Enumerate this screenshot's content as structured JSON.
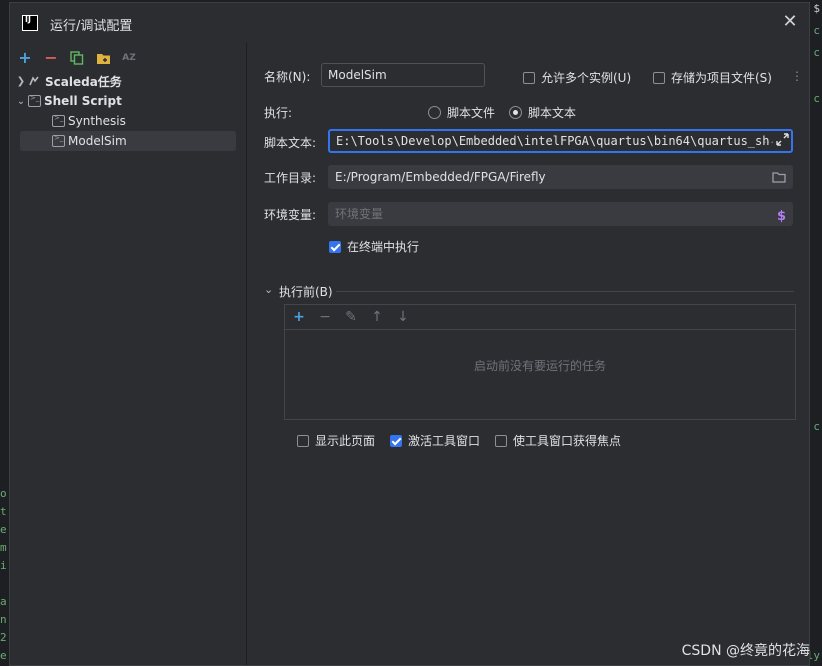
{
  "window": {
    "title": "运行/调试配置",
    "close_label": "✕"
  },
  "background_editor": {
    "left_glyphs": [
      "o",
      "t",
      "e",
      "m",
      "i",
      "",
      "a",
      "n",
      "t",
      "2",
      "e"
    ],
    "right_glyphs": [
      "$",
      "c",
      "c",
      "c",
      "c",
      "ly"
    ]
  },
  "toolbar": {
    "add": "+",
    "remove": "−",
    "copy": "copy",
    "folder": "folder",
    "sort": "AZ"
  },
  "tree": [
    {
      "label": "Scaleda任务",
      "expanded": false,
      "bold": true
    },
    {
      "label": "Shell Script",
      "expanded": true,
      "bold": true
    },
    {
      "label": "Synthesis",
      "child": true
    },
    {
      "label": "ModelSim",
      "child": true,
      "selected": true
    }
  ],
  "form": {
    "name_label": "名称(N):",
    "name_value": "ModelSim",
    "allow_multiple_label": "允许多个实例(U)",
    "allow_multiple_checked": false,
    "store_as_file_label": "存储为项目文件(S)",
    "store_as_file_checked": false,
    "execute_label": "执行:",
    "radio_script_file": "脚本文件",
    "radio_script_text": "脚本文本",
    "selected_radio": "脚本文本",
    "script_text_label": "脚本文本:",
    "script_text_value": "E:\\Tools\\Develop\\Embedded\\intelFPGA\\quartus\\bin64\\quartus_sh",
    "workdir_label": "工作目录:",
    "workdir_value": "E:/Program/Embedded/FPGA/Firefly",
    "env_label": "环境变量:",
    "env_placeholder": "环境变量",
    "run_in_terminal_label": "在终端中执行",
    "run_in_terminal_checked": true
  },
  "before_launch": {
    "header": "执行前(B)",
    "empty_message": "启动前没有要运行的任务",
    "show_page_label": "显示此页面",
    "show_page_checked": false,
    "activate_tool_window_label": "激活工具窗口",
    "activate_tool_window_checked": true,
    "focus_tool_window_label": "使工具窗口获得焦点",
    "focus_tool_window_checked": false
  },
  "watermark": "CSDN @终竟的花海",
  "colors": {
    "accent": "#3574f0",
    "add_green": "#4aa3df",
    "remove_red": "#db5c5c",
    "copy_green": "#5fb865",
    "folder_yellow": "#e0b341",
    "dollar_purple": "#b57cf5"
  }
}
